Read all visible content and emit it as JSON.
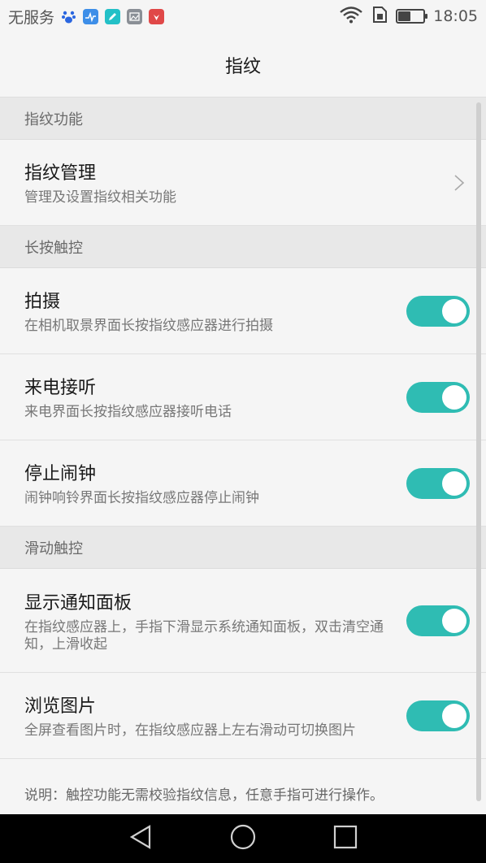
{
  "status_bar": {
    "carrier": "无服务",
    "time": "18:05",
    "battery_level": 0.45,
    "apps": [
      "baidu-icon",
      "monitor-icon",
      "note-icon",
      "gallery-icon",
      "huawei-icon"
    ]
  },
  "title": "指纹",
  "sections": [
    {
      "header": "指纹功能",
      "rows": [
        {
          "title": "指纹管理",
          "subtitle": "管理及设置指纹相关功能",
          "control": "chevron"
        }
      ]
    },
    {
      "header": "长按触控",
      "rows": [
        {
          "title": "拍摄",
          "subtitle": "在相机取景界面长按指纹感应器进行拍摄",
          "control": "toggle",
          "on": true
        },
        {
          "title": "来电接听",
          "subtitle": "来电界面长按指纹感应器接听电话",
          "control": "toggle",
          "on": true
        },
        {
          "title": "停止闹钟",
          "subtitle": "闹钟响铃界面长按指纹感应器停止闹钟",
          "control": "toggle",
          "on": true
        }
      ]
    },
    {
      "header": "滑动触控",
      "rows": [
        {
          "title": "显示通知面板",
          "subtitle": "在指纹感应器上，手指下滑显示系统通知面板，双击清空通知，上滑收起",
          "control": "toggle",
          "on": true
        },
        {
          "title": "浏览图片",
          "subtitle": "全屏查看图片时，在指纹感应器上左右滑动可切换图片",
          "control": "toggle",
          "on": true
        }
      ]
    }
  ],
  "note": "说明：触控功能无需校验指纹信息，任意手指可进行操作。",
  "colors": {
    "toggle_on": "#2fbcb3",
    "section_bg": "#e8e8e8",
    "background": "#f5f5f5"
  }
}
